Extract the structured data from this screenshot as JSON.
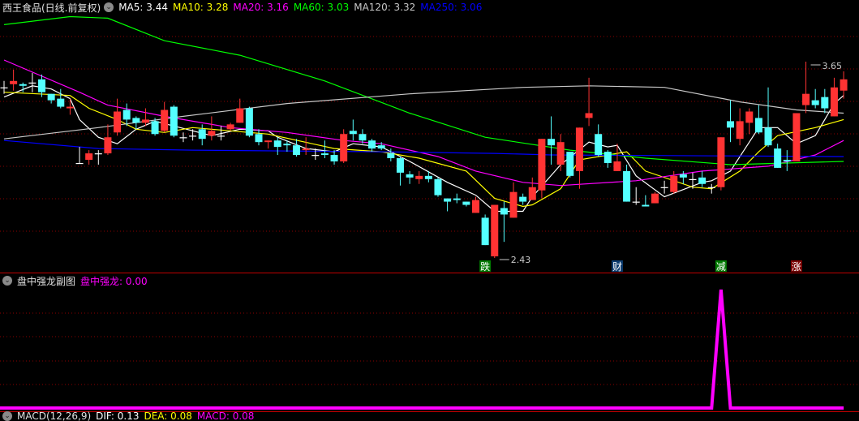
{
  "header": {
    "title": "西王食品(日线.前复权)",
    "ma": [
      {
        "label": "MA5: 3.44",
        "color": "#ffffff"
      },
      {
        "label": "MA10: 3.28",
        "color": "#ffff00"
      },
      {
        "label": "MA20: 3.16",
        "color": "#ff00ff"
      },
      {
        "label": "MA60: 3.03",
        "color": "#00ff00"
      },
      {
        "label": "MA120: 3.32",
        "color": "#c8c8c8"
      },
      {
        "label": "MA250: 3.06",
        "color": "#0000ff"
      }
    ]
  },
  "sub_header": {
    "title": "盘中强龙副图",
    "value_label": "盘中强龙: 0.00",
    "color": "#ff00ff"
  },
  "macd_header": {
    "title": "MACD(12,26,9)",
    "dif": "DIF: 0.13",
    "dea": "DEA: 0.08",
    "macd": "MACD: 0.08"
  },
  "colors": {
    "up": "#ff3333",
    "down": "#54ffff",
    "flat": "#ffffff",
    "grid": "#8b0000",
    "separator": "#c00000"
  },
  "chart_data": [
    {
      "type": "candlestick",
      "ylim": [
        2.43,
        3.65
      ],
      "grid": true,
      "ohlc": [
        [
          3.49,
          3.53,
          3.45,
          3.49
        ],
        [
          3.51,
          3.6,
          3.47,
          3.53
        ],
        [
          3.51,
          3.52,
          3.46,
          3.5
        ],
        [
          3.52,
          3.58,
          3.46,
          3.52
        ],
        [
          3.54,
          3.57,
          3.43,
          3.46
        ],
        [
          3.45,
          3.45,
          3.39,
          3.41
        ],
        [
          3.42,
          3.48,
          3.36,
          3.37
        ],
        [
          3.36,
          3.42,
          3.32,
          3.37
        ],
        [
          3.02,
          3.12,
          3.02,
          3.02
        ],
        [
          3.04,
          3.1,
          3.01,
          3.08
        ],
        [
          3.08,
          3.1,
          3.01,
          3.08
        ],
        [
          3.08,
          3.26,
          3.07,
          3.18
        ],
        [
          3.21,
          3.42,
          3.19,
          3.34
        ],
        [
          3.35,
          3.39,
          3.25,
          3.29
        ],
        [
          3.3,
          3.31,
          3.23,
          3.27
        ],
        [
          3.27,
          3.36,
          3.25,
          3.29
        ],
        [
          3.28,
          3.3,
          3.19,
          3.2
        ],
        [
          3.22,
          3.4,
          3.21,
          3.35
        ],
        [
          3.37,
          3.38,
          3.18,
          3.19
        ],
        [
          3.18,
          3.21,
          3.15,
          3.18
        ],
        [
          3.19,
          3.23,
          3.16,
          3.19
        ],
        [
          3.23,
          3.26,
          3.13,
          3.17
        ],
        [
          3.19,
          3.31,
          3.16,
          3.22
        ],
        [
          3.19,
          3.25,
          3.16,
          3.19
        ],
        [
          3.23,
          3.27,
          3.22,
          3.26
        ],
        [
          3.27,
          3.42,
          3.27,
          3.36
        ],
        [
          3.36,
          3.37,
          3.18,
          3.19
        ],
        [
          3.2,
          3.23,
          3.13,
          3.15
        ],
        [
          3.15,
          3.16,
          3.11,
          3.16
        ],
        [
          3.16,
          3.18,
          3.07,
          3.12
        ],
        [
          3.14,
          3.16,
          3.09,
          3.13
        ],
        [
          3.13,
          3.17,
          3.06,
          3.07
        ],
        [
          3.1,
          3.18,
          3.07,
          3.11
        ],
        [
          3.07,
          3.11,
          3.04,
          3.07
        ],
        [
          3.08,
          3.16,
          3.05,
          3.07
        ],
        [
          3.07,
          3.1,
          3.01,
          3.03
        ],
        [
          3.03,
          3.23,
          3.02,
          3.2
        ],
        [
          3.22,
          3.29,
          3.16,
          3.2
        ],
        [
          3.2,
          3.23,
          3.14,
          3.16
        ],
        [
          3.16,
          3.17,
          3.09,
          3.11
        ],
        [
          3.13,
          3.15,
          3.1,
          3.11
        ],
        [
          3.08,
          3.11,
          3.03,
          3.05
        ],
        [
          3.05,
          3.06,
          2.88,
          2.96
        ],
        [
          2.95,
          2.97,
          2.89,
          2.93
        ],
        [
          2.92,
          2.97,
          2.89,
          2.94
        ],
        [
          2.94,
          2.97,
          2.9,
          2.92
        ],
        [
          2.92,
          2.93,
          2.81,
          2.82
        ],
        [
          2.8,
          2.8,
          2.72,
          2.78
        ],
        [
          2.8,
          2.83,
          2.77,
          2.79
        ],
        [
          2.78,
          2.78,
          2.75,
          2.76
        ],
        [
          2.71,
          2.81,
          2.71,
          2.79
        ],
        [
          2.68,
          2.7,
          2.51,
          2.51
        ],
        [
          2.44,
          2.76,
          2.43,
          2.76
        ],
        [
          2.74,
          2.78,
          2.53,
          2.7
        ],
        [
          2.68,
          2.9,
          2.68,
          2.84
        ],
        [
          2.81,
          2.83,
          2.76,
          2.78
        ],
        [
          2.79,
          2.93,
          2.79,
          2.87
        ],
        [
          2.85,
          3.17,
          2.8,
          3.17
        ],
        [
          3.17,
          3.31,
          3.01,
          3.13
        ],
        [
          3.01,
          3.2,
          2.97,
          3.15
        ],
        [
          3.09,
          3.09,
          2.93,
          2.94
        ],
        [
          2.97,
          3.24,
          2.86,
          3.24
        ],
        [
          3.3,
          3.55,
          3.25,
          3.33
        ],
        [
          3.2,
          3.26,
          3.06,
          3.07
        ],
        [
          3.09,
          3.1,
          2.99,
          3.02
        ],
        [
          2.97,
          3.14,
          2.97,
          3.03
        ],
        [
          2.97,
          3.01,
          2.78,
          2.78
        ],
        [
          2.78,
          2.87,
          2.76,
          2.78
        ],
        [
          2.76,
          2.82,
          2.75,
          2.75
        ],
        [
          2.77,
          2.84,
          2.77,
          2.83
        ],
        [
          2.87,
          2.91,
          2.83,
          2.87
        ],
        [
          2.84,
          2.97,
          2.83,
          2.94
        ],
        [
          2.95,
          2.97,
          2.89,
          2.93
        ],
        [
          2.92,
          2.96,
          2.86,
          2.92
        ],
        [
          2.93,
          2.97,
          2.87,
          2.89
        ],
        [
          2.87,
          2.89,
          2.83,
          2.87
        ],
        [
          2.87,
          3.18,
          2.85,
          3.18
        ],
        [
          3.28,
          3.41,
          3.15,
          3.24
        ],
        [
          3.17,
          3.36,
          3.13,
          3.28
        ],
        [
          3.27,
          3.36,
          3.2,
          3.34
        ],
        [
          3.3,
          3.38,
          3.2,
          3.21
        ],
        [
          3.24,
          3.49,
          3.12,
          3.13
        ],
        [
          3.11,
          3.14,
          2.99,
          2.99
        ],
        [
          3.04,
          3.1,
          2.97,
          3.03
        ],
        [
          3.03,
          3.33,
          3.03,
          3.33
        ],
        [
          3.38,
          3.65,
          3.33,
          3.45
        ],
        [
          3.41,
          3.48,
          3.36,
          3.38
        ],
        [
          3.43,
          3.48,
          3.33,
          3.36
        ],
        [
          3.31,
          3.55,
          3.31,
          3.49
        ],
        [
          3.47,
          3.59,
          3.42,
          3.54
        ]
      ],
      "ma_lines": [
        {
          "name": "MA5",
          "color": "#ffffff",
          "points": [
            [
              0,
              3.43
            ],
            [
              3,
              3.5
            ],
            [
              5,
              3.48
            ],
            [
              7,
              3.42
            ],
            [
              8,
              3.29
            ],
            [
              10,
              3.18
            ],
            [
              12,
              3.14
            ],
            [
              14,
              3.23
            ],
            [
              16,
              3.28
            ],
            [
              18,
              3.25
            ],
            [
              22,
              3.19
            ],
            [
              25,
              3.23
            ],
            [
              28,
              3.22
            ],
            [
              29,
              3.18
            ],
            [
              32,
              3.11
            ],
            [
              35,
              3.09
            ],
            [
              37,
              3.14
            ],
            [
              40,
              3.12
            ],
            [
              43,
              3.03
            ],
            [
              47,
              2.9
            ],
            [
              50,
              2.82
            ],
            [
              52,
              2.72
            ],
            [
              55,
              2.72
            ],
            [
              56,
              2.81
            ],
            [
              59,
              3.01
            ],
            [
              62,
              3.15
            ],
            [
              64,
              3.12
            ],
            [
              65,
              3.13
            ],
            [
              67,
              2.94
            ],
            [
              70,
              2.81
            ],
            [
              74,
              2.9
            ],
            [
              75,
              2.91
            ],
            [
              77,
              2.97
            ],
            [
              80,
              3.24
            ],
            [
              82,
              3.24
            ],
            [
              84,
              3.14
            ],
            [
              86,
              3.19
            ],
            [
              88,
              3.39
            ],
            [
              89,
              3.44
            ]
          ]
        },
        {
          "name": "MA10",
          "color": "#ffff00",
          "points": [
            [
              0,
              3.46
            ],
            [
              7,
              3.44
            ],
            [
              9,
              3.36
            ],
            [
              12,
              3.29
            ],
            [
              14,
              3.23
            ],
            [
              17,
              3.21
            ],
            [
              20,
              3.24
            ],
            [
              24,
              3.22
            ],
            [
              28,
              3.2
            ],
            [
              35,
              3.11
            ],
            [
              40,
              3.09
            ],
            [
              44,
              3.05
            ],
            [
              49,
              2.97
            ],
            [
              52,
              2.8
            ],
            [
              55,
              2.75
            ],
            [
              56,
              2.76
            ],
            [
              59,
              2.86
            ],
            [
              61,
              3.04
            ],
            [
              66,
              3.09
            ],
            [
              68,
              2.97
            ],
            [
              73,
              2.87
            ],
            [
              75,
              2.86
            ],
            [
              78,
              2.97
            ],
            [
              80,
              3.09
            ],
            [
              82,
              3.19
            ],
            [
              86,
              3.24
            ],
            [
              89,
              3.29
            ]
          ]
        },
        {
          "name": "MA20",
          "color": "#ff00ff",
          "points": [
            [
              0,
              3.66
            ],
            [
              8,
              3.46
            ],
            [
              11,
              3.38
            ],
            [
              17,
              3.31
            ],
            [
              24,
              3.24
            ],
            [
              30,
              3.21
            ],
            [
              36,
              3.16
            ],
            [
              40,
              3.14
            ],
            [
              46,
              3.06
            ],
            [
              50,
              2.97
            ],
            [
              55,
              2.9
            ],
            [
              59,
              2.88
            ],
            [
              67,
              2.91
            ],
            [
              74,
              2.97
            ],
            [
              81,
              3.0
            ],
            [
              86,
              3.07
            ],
            [
              89,
              3.16
            ]
          ]
        },
        {
          "name": "MA60",
          "color": "#00ff00",
          "points": [
            [
              0,
              3.88
            ],
            [
              7,
              3.93
            ],
            [
              11,
              3.92
            ],
            [
              17,
              3.78
            ],
            [
              25,
              3.69
            ],
            [
              34,
              3.53
            ],
            [
              43,
              3.33
            ],
            [
              51,
              3.18
            ],
            [
              60,
              3.1
            ],
            [
              68,
              3.05
            ],
            [
              77,
              3.01
            ],
            [
              89,
              3.03
            ]
          ]
        },
        {
          "name": "MA120",
          "color": "#c8c8c8",
          "points": [
            [
              0,
              3.17
            ],
            [
              10,
              3.24
            ],
            [
              19,
              3.31
            ],
            [
              30,
              3.39
            ],
            [
              43,
              3.45
            ],
            [
              55,
              3.49
            ],
            [
              62,
              3.5
            ],
            [
              70,
              3.49
            ],
            [
              78,
              3.4
            ],
            [
              84,
              3.35
            ],
            [
              89,
              3.33
            ]
          ]
        },
        {
          "name": "MA250",
          "color": "#0000ff",
          "points": [
            [
              0,
              3.16
            ],
            [
              10,
              3.11
            ],
            [
              20,
              3.1
            ],
            [
              40,
              3.09
            ],
            [
              52,
              3.08
            ],
            [
              58,
              3.07
            ],
            [
              89,
              3.06
            ]
          ]
        }
      ],
      "annotations": [
        {
          "index": 52,
          "price": 2.43,
          "label": "2.43",
          "anchor": "low"
        },
        {
          "index": 85,
          "price": 3.65,
          "label": "3.65",
          "anchor": "high"
        }
      ],
      "event_markers": [
        {
          "index": 51,
          "label": "跌",
          "bg": "#007a00"
        },
        {
          "index": 65,
          "label": "财",
          "bg": "#0a3a6e"
        },
        {
          "index": 76,
          "label": "减",
          "bg": "#007a00"
        },
        {
          "index": 84,
          "label": "涨",
          "bg": "#7a0000"
        }
      ]
    },
    {
      "type": "line",
      "name": "盘中强龙",
      "color": "#ff00ff",
      "grid": true,
      "values": [
        0,
        0,
        0,
        0,
        0,
        0,
        0,
        0,
        0,
        0,
        0,
        0,
        0,
        0,
        0,
        0,
        0,
        0,
        0,
        0,
        0,
        0,
        0,
        0,
        0,
        0,
        0,
        0,
        0,
        0,
        0,
        0,
        0,
        0,
        0,
        0,
        0,
        0,
        0,
        0,
        0,
        0,
        0,
        0,
        0,
        0,
        0,
        0,
        0,
        0,
        0,
        0,
        0,
        0,
        0,
        0,
        0,
        0,
        0,
        0,
        0,
        0,
        0,
        0,
        0,
        0,
        0,
        0,
        0,
        0,
        0,
        0,
        0,
        0,
        0,
        0,
        1,
        0,
        0,
        0,
        0,
        0,
        0,
        0,
        0,
        0,
        0,
        0,
        0,
        0
      ],
      "ylim": [
        0,
        1
      ]
    }
  ]
}
